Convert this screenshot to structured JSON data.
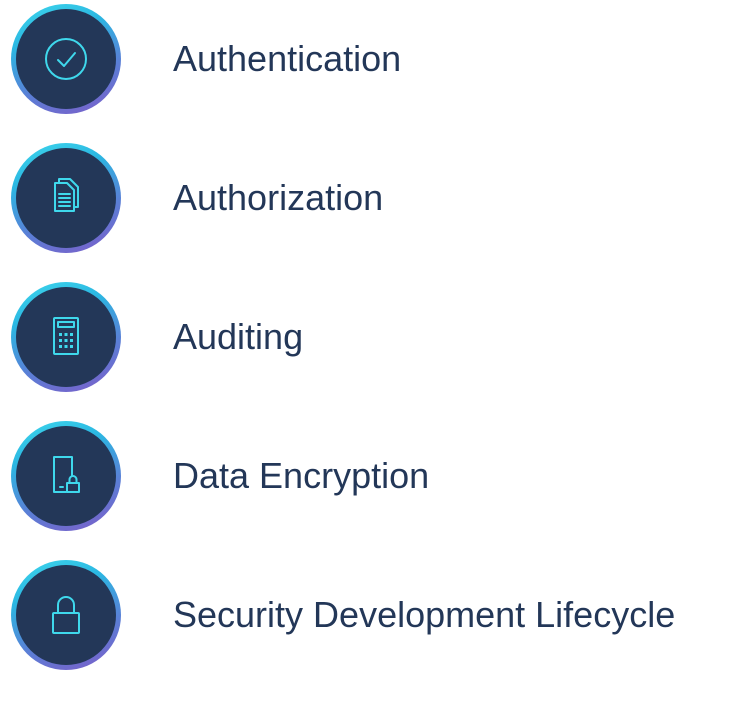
{
  "items": [
    {
      "label": "Authentication",
      "icon": "check-circle-icon"
    },
    {
      "label": "Authorization",
      "icon": "documents-icon"
    },
    {
      "label": "Auditing",
      "icon": "calculator-icon"
    },
    {
      "label": "Data Encryption",
      "icon": "device-lock-icon"
    },
    {
      "label": "Security Development Lifecycle",
      "icon": "padlock-icon"
    }
  ],
  "colors": {
    "disc": "#233758",
    "icon_stroke": "#3fd8ec",
    "ring_start": "#3fd8ec",
    "ring_end": "#7d5cc8",
    "text": "#233758"
  }
}
